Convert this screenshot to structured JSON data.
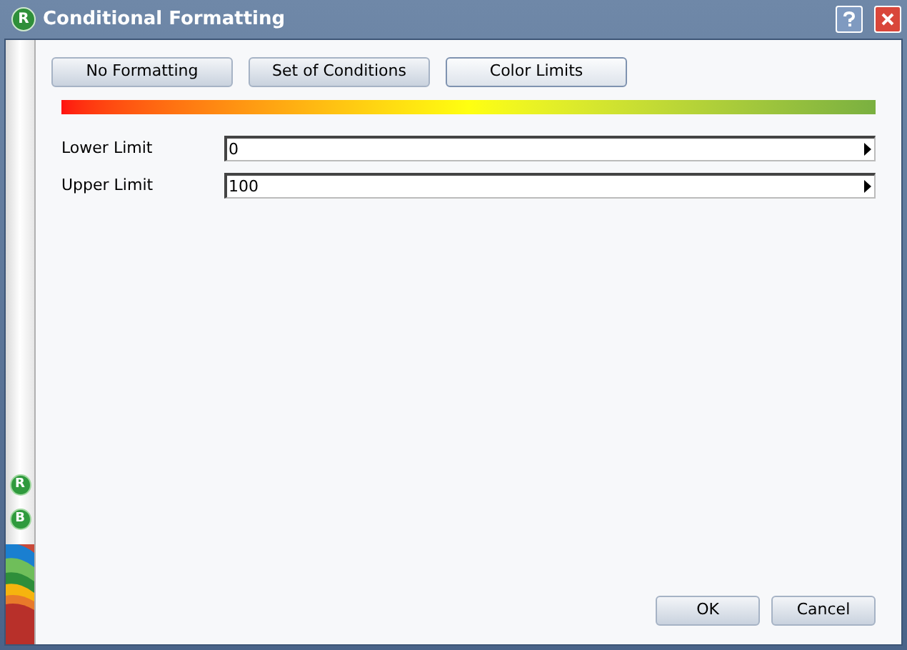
{
  "window": {
    "title": "Conditional Formatting",
    "icon_letter": "R"
  },
  "side_icons": [
    "R",
    "B"
  ],
  "modes": [
    {
      "label": "No Formatting",
      "selected": false
    },
    {
      "label": "Set of Conditions",
      "selected": false
    },
    {
      "label": "Color Limits",
      "selected": true
    }
  ],
  "limits": [
    {
      "label": "Lower Limit",
      "value": "0"
    },
    {
      "label": "Upper Limit",
      "value": "100"
    }
  ],
  "buttons": [
    "OK",
    "Cancel"
  ]
}
